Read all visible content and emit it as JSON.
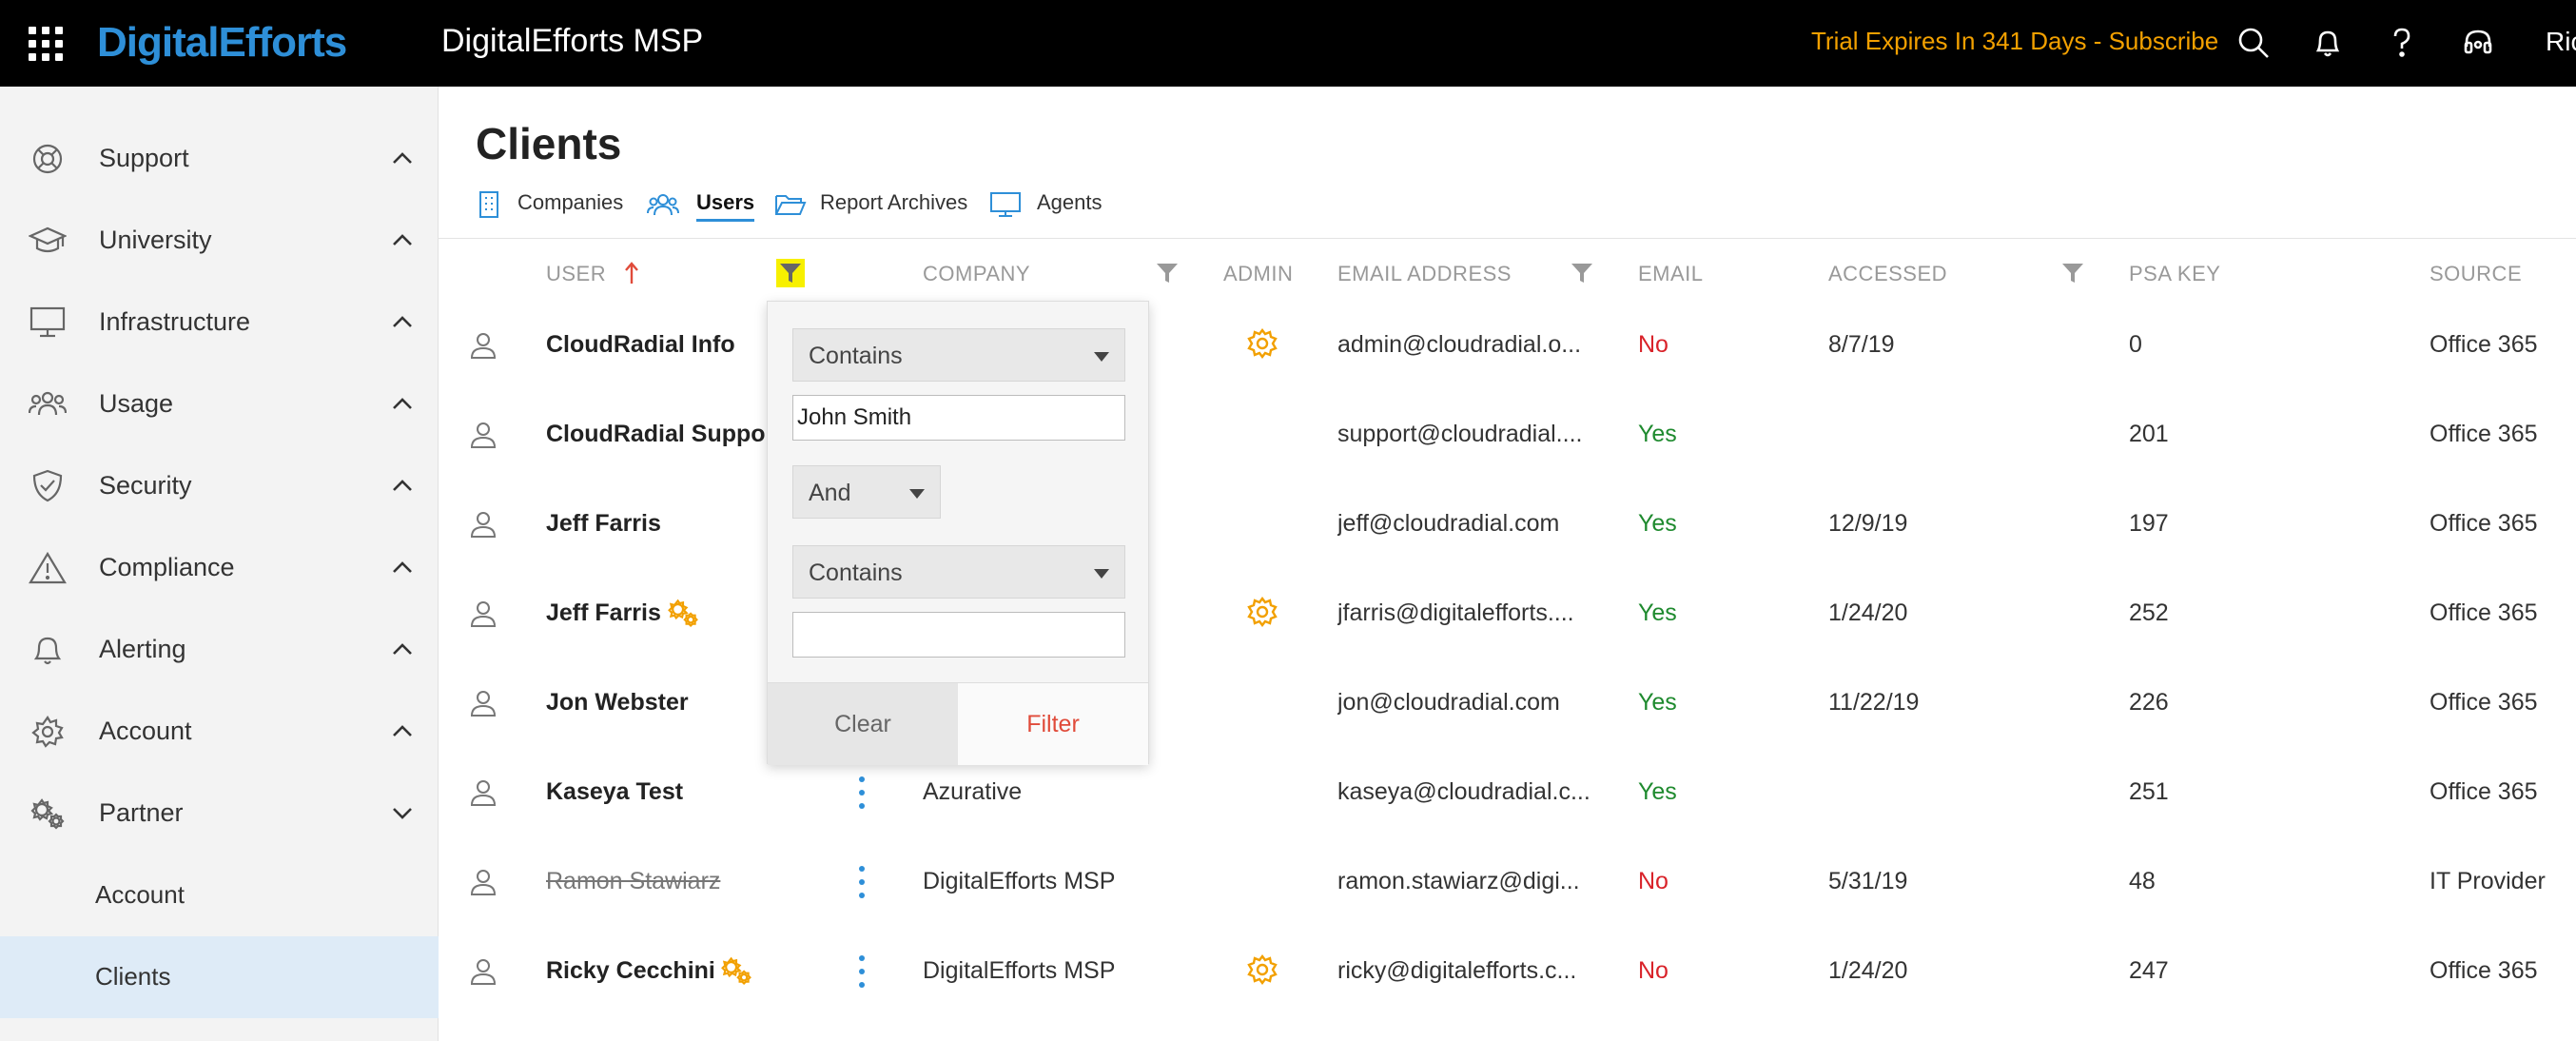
{
  "header": {
    "logo": "DigitalEfforts",
    "app_title": "DigitalEfforts MSP",
    "trial": "Trial Expires In 341 Days - Subscribe",
    "user_short": "Ric"
  },
  "sidebar": {
    "items": [
      {
        "label": "Support",
        "icon": "lifebuoy-icon"
      },
      {
        "label": "University",
        "icon": "graduation-cap-icon"
      },
      {
        "label": "Infrastructure",
        "icon": "monitor-icon"
      },
      {
        "label": "Usage",
        "icon": "users-icon"
      },
      {
        "label": "Security",
        "icon": "shield-icon"
      },
      {
        "label": "Compliance",
        "icon": "warning-icon"
      },
      {
        "label": "Alerting",
        "icon": "bell-icon"
      },
      {
        "label": "Account",
        "icon": "gear-icon"
      },
      {
        "label": "Partner",
        "icon": "gears-icon"
      }
    ],
    "sub_items": [
      "Account",
      "Clients"
    ]
  },
  "page": {
    "title": "Clients",
    "tabs": [
      "Companies",
      "Users",
      "Report Archives",
      "Agents"
    ]
  },
  "table": {
    "columns": [
      "USER",
      "COMPANY",
      "ADMIN",
      "EMAIL ADDRESS",
      "EMAIL",
      "ACCESSED",
      "PSA KEY",
      "SOURCE"
    ],
    "rows": [
      {
        "user": "CloudRadial Info",
        "company": "",
        "email_address": "admin@cloudradial.o...",
        "email": "No",
        "accessed": "8/7/19",
        "psa_key": "0",
        "source": "Office 365"
      },
      {
        "user": "CloudRadial Suppor",
        "company": "",
        "email_address": "support@cloudradial....",
        "email": "Yes",
        "accessed": "",
        "psa_key": "201",
        "source": "Office 365"
      },
      {
        "user": "Jeff Farris",
        "company": "",
        "email_address": "jeff@cloudradial.com",
        "email": "Yes",
        "accessed": "12/9/19",
        "psa_key": "197",
        "source": "Office 365"
      },
      {
        "user": "Jeff Farris",
        "company": "",
        "email_address": "jfarris@digitalefforts....",
        "email": "Yes",
        "accessed": "1/24/20",
        "psa_key": "252",
        "source": "Office 365"
      },
      {
        "user": "Jon Webster",
        "company": "",
        "email_address": "jon@cloudradial.com",
        "email": "Yes",
        "accessed": "11/22/19",
        "psa_key": "226",
        "source": "Office 365"
      },
      {
        "user": "Kaseya Test",
        "company": "Azurative",
        "email_address": "kaseya@cloudradial.c...",
        "email": "Yes",
        "accessed": "",
        "psa_key": "251",
        "source": "Office 365"
      },
      {
        "user": "Ramon Stawiarz",
        "company": "DigitalEfforts MSP",
        "email_address": "ramon.stawiarz@digi...",
        "email": "No",
        "accessed": "5/31/19",
        "psa_key": "48",
        "source": "IT Provider"
      },
      {
        "user": "Ricky Cecchini",
        "company": "DigitalEfforts MSP",
        "email_address": "ricky@digitalefforts.c...",
        "email": "No",
        "accessed": "1/24/20",
        "psa_key": "247",
        "source": "Office 365"
      }
    ]
  },
  "filter_popup": {
    "operator1": "Contains",
    "value1": "John Smith",
    "logic": "And",
    "operator2": "Contains",
    "value2": "",
    "clear_label": "Clear",
    "filter_label": "Filter"
  },
  "colors": {
    "accent": "#2e8fd8",
    "trial": "#f2a000",
    "yes": "#1e8a2e",
    "no": "#d9232a",
    "partner_icon": "#f2a000",
    "active_filter_highlight": "#f7f000"
  }
}
